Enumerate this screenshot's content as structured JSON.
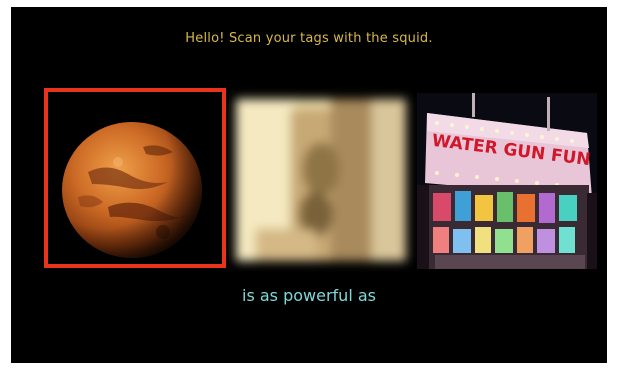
{
  "app": {
    "greeting": "Hello! Scan your tags with the squid.",
    "caption": "is as powerful as"
  },
  "cards": [
    {
      "name": "mars",
      "icon": "planet-mars-image",
      "selected": true
    },
    {
      "name": "blurred-photo",
      "icon": "blurred-photo-image",
      "selected": false
    },
    {
      "name": "water-gun-fun-booth",
      "icon": "carnival-booth-image",
      "selected": false
    }
  ],
  "booth_sign": {
    "text": "WATER GUN FUN"
  },
  "colors": {
    "background": "#000000",
    "greeting_text": "#d8b84a",
    "caption_text": "#7fd8d8",
    "selection_border": "#e8341c"
  }
}
